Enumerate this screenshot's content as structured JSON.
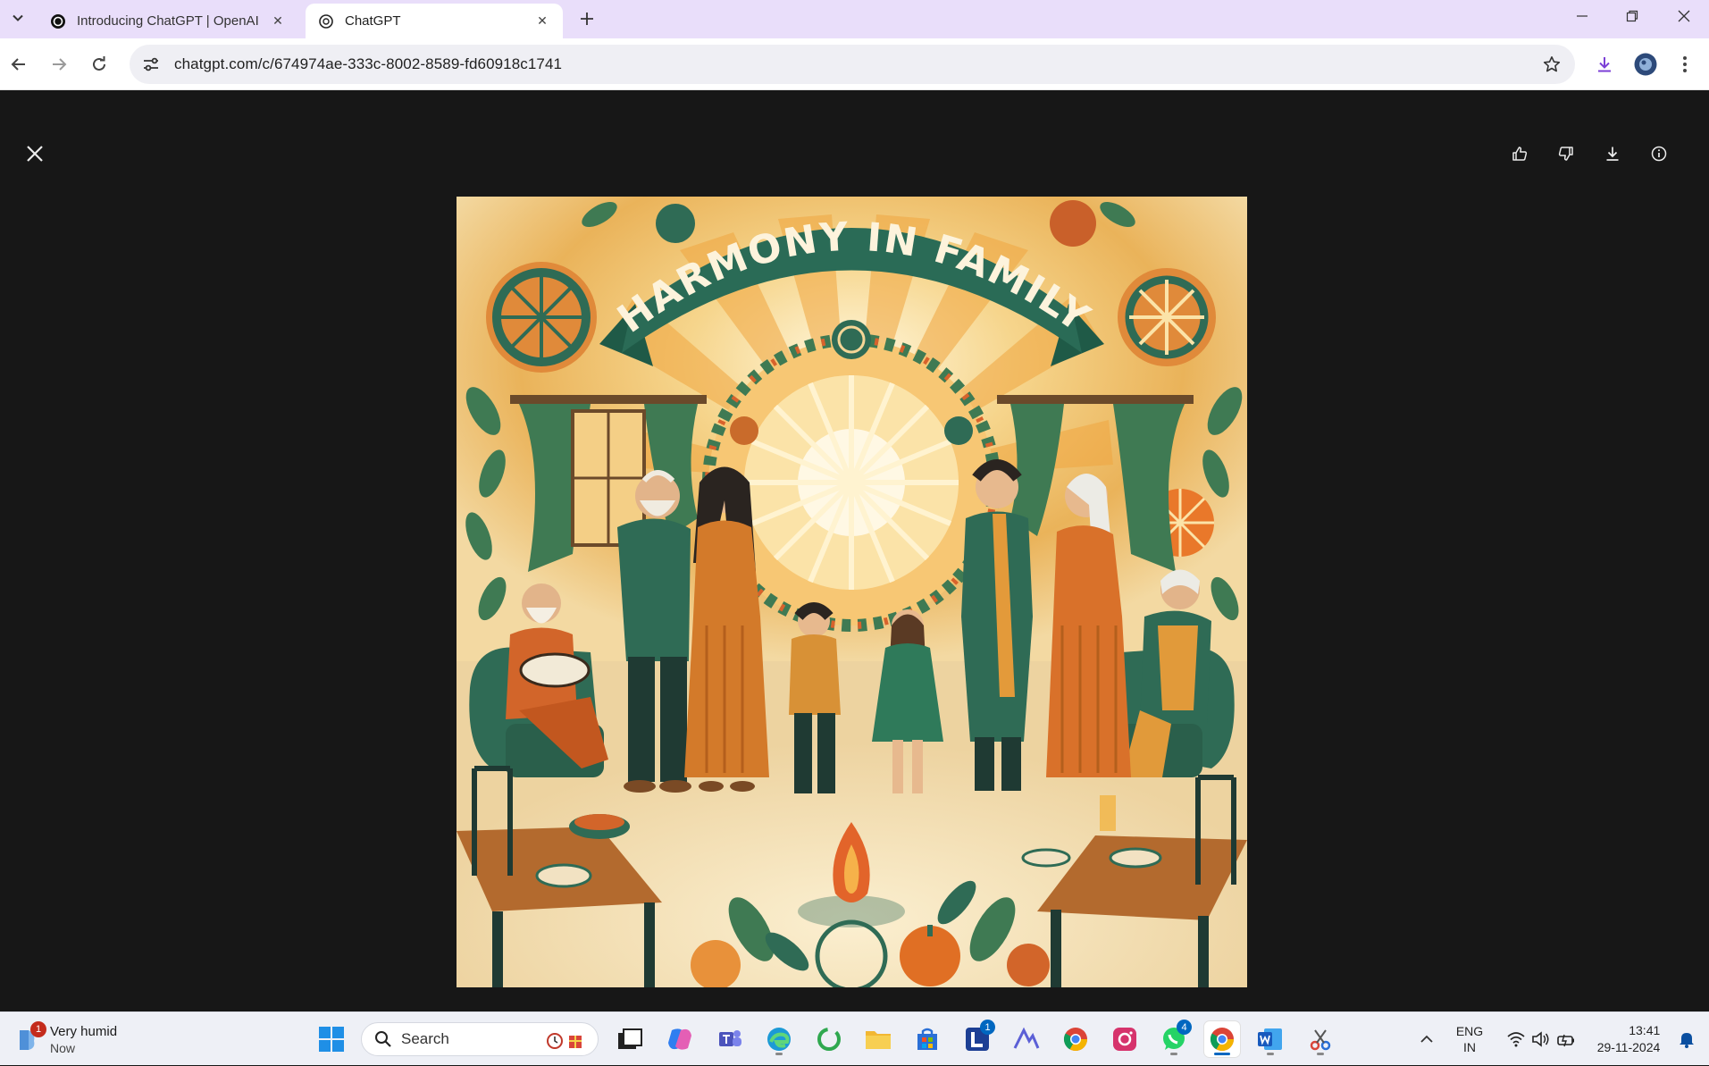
{
  "browser": {
    "tabs": [
      {
        "title": "Introducing ChatGPT | OpenAI",
        "active": false
      },
      {
        "title": "ChatGPT",
        "active": true
      }
    ],
    "url": "chatgpt.com/c/674974ae-333c-8002-8589-fd60918c1741"
  },
  "image": {
    "banner_text": "HARMONY IN FAMILY"
  },
  "taskbar": {
    "weather_text": "Very humid",
    "weather_time": "Now",
    "weather_badge": "1",
    "search_placeholder": "Search",
    "teams_badge": "1",
    "whatsapp_badge": "4",
    "language_line1": "ENG",
    "language_line2": "IN",
    "time": "13:41",
    "date": "29-11-2024"
  },
  "colors": {
    "tabbar": "#e9defa",
    "viewer_bg": "#171717",
    "taskbar": "#eef0f6",
    "accent": "#0067c0"
  }
}
